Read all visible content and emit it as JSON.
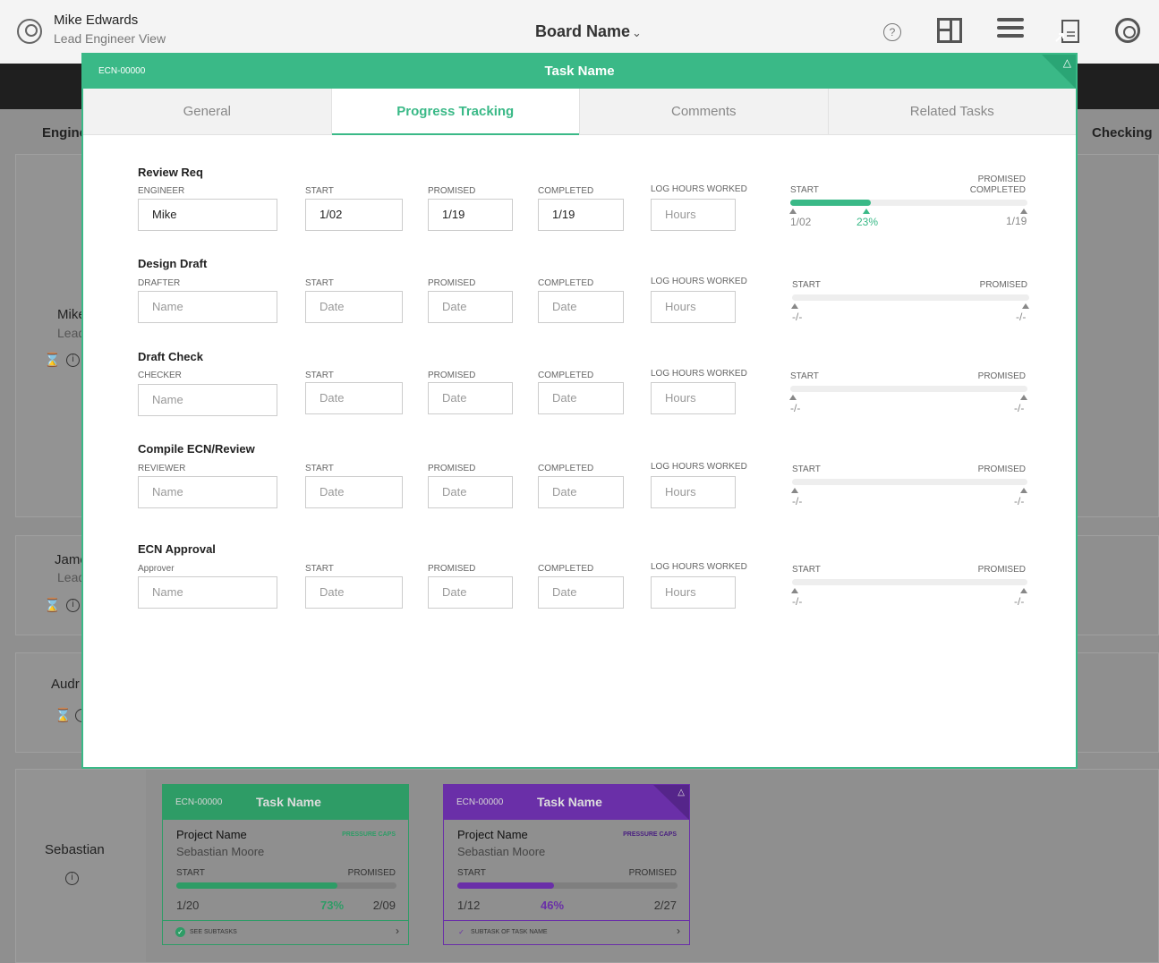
{
  "header": {
    "user_name": "Mike Edwards",
    "user_role": "Lead Engineer View",
    "board_name": "Board Name",
    "help_symbol": "?"
  },
  "background": {
    "column_left": "Engine",
    "column_right": "Checking",
    "rows": [
      {
        "name": "Mike",
        "role": "Lead"
      },
      {
        "name": "Jame",
        "role": "Lead"
      },
      {
        "name": "Audr",
        "role": ""
      },
      {
        "name": "Sebastian",
        "role": ""
      }
    ],
    "cards": [
      {
        "ecn": "ECN-00000",
        "title": "Task Name",
        "project": "Project Name",
        "person": "Sebastian Moore",
        "tag": "PRESSURE CAPS",
        "start_label": "START",
        "promised_label": "PROMISED",
        "start_date": "1/20",
        "progress_pct": "73%",
        "progress_fraction": 0.73,
        "promised_date": "2/09",
        "footer": "SEE SUBTASKS",
        "accent": "#2e9c66"
      },
      {
        "ecn": "ECN-00000",
        "title": "Task Name",
        "project": "Project Name",
        "person": "Sebastian Moore",
        "tag": "PRESSURE CAPS",
        "start_label": "START",
        "promised_label": "PROMISED",
        "start_date": "1/12",
        "progress_pct": "46%",
        "progress_fraction": 0.46,
        "promised_date": "2/27",
        "footer": "SUBTASK OF TASK NAME",
        "accent": "#6a2fa8"
      }
    ]
  },
  "modal": {
    "ecn": "ECN-00000",
    "title": "Task Name",
    "accent": "#3ab987",
    "tabs": [
      "General",
      "Progress Tracking",
      "Comments",
      "Related Tasks"
    ],
    "active_tab": "Progress Tracking",
    "labels": {
      "start": "START",
      "promised": "PROMISED",
      "completed": "COMPLETED",
      "log_hours": "LOG HOURS WORKED",
      "promised_completed_1": "PROMISED",
      "promised_completed_2": "COMPLETED"
    },
    "placeholders": {
      "name": "Name",
      "date": "Date",
      "hours": "Hours"
    },
    "sections": [
      {
        "title": "Review Req",
        "person_label": "ENGINEER",
        "person": "Mike",
        "start": "1/02",
        "promised": "1/19",
        "completed": "1/19",
        "hours": "",
        "track_start": "1/02",
        "track_end": "1/19",
        "track_pct": "23%",
        "track_fraction": 0.23
      },
      {
        "title": "Design Draft",
        "person_label": "DRAFTER",
        "person": "",
        "start": "",
        "promised": "",
        "completed": "",
        "hours": "",
        "track_start": "-/-",
        "track_end": "-/-"
      },
      {
        "title": "Draft Check",
        "person_label": "CHECKER",
        "person": "",
        "start": "",
        "promised": "",
        "completed": "",
        "hours": "",
        "track_start": "-/-",
        "track_end": "-/-"
      },
      {
        "title": "Compile ECN/Review",
        "person_label": "REVIEWER",
        "person": "",
        "start": "",
        "promised": "",
        "completed": "",
        "hours": "",
        "track_start": "-/-",
        "track_end": "-/-"
      },
      {
        "title": "ECN Approval",
        "person_label": "Approver",
        "person": "",
        "start": "",
        "promised": "",
        "completed": "",
        "hours": "",
        "track_start": "-/-",
        "track_end": "-/-"
      }
    ]
  }
}
